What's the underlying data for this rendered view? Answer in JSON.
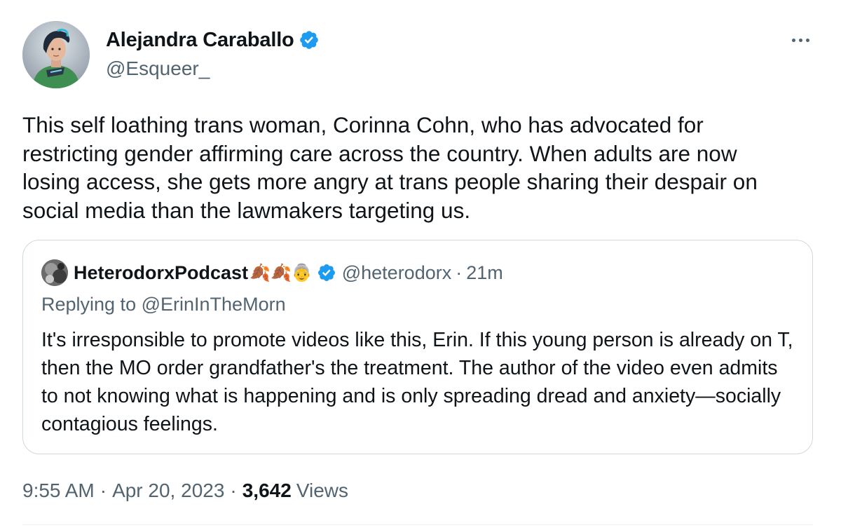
{
  "author": {
    "display_name": "Alejandra Caraballo",
    "handle": "@Esqueer_",
    "verified": true
  },
  "tweet": {
    "text": "This self loathing trans woman, Corinna Cohn, who has advocated for restricting gender affirming care across the country. When adults are now losing access, she gets more angry at trans people sharing their despair on social media than the lawmakers targeting us."
  },
  "quoted_tweet": {
    "display_name": "HeterodorxPodcast",
    "name_emojis": "🍂🍂👵",
    "verified": true,
    "handle": "@heterodorx",
    "separator": "·",
    "time_ago": "21m",
    "replying_prefix": "Replying to",
    "replying_to": "@ErinInTheMorn",
    "text": "It's irresponsible to promote videos like this, Erin. If this young person is already on T, then the MO order grandfather's the treatment. The author of the video even admits to not knowing what is happening and is only spreading dread and anxiety—socially contagious feelings."
  },
  "meta": {
    "time": "9:55 AM",
    "separator": "·",
    "date": "Apr 20, 2023",
    "views_count": "3,642",
    "views_label": "Views"
  },
  "icons": {
    "verified": "verified-badge-icon",
    "more": "more-options-icon"
  },
  "colors": {
    "verified_blue": "#1d9bf0",
    "text_primary": "#0f1419",
    "text_secondary": "#536471",
    "border": "#cfd9de"
  }
}
